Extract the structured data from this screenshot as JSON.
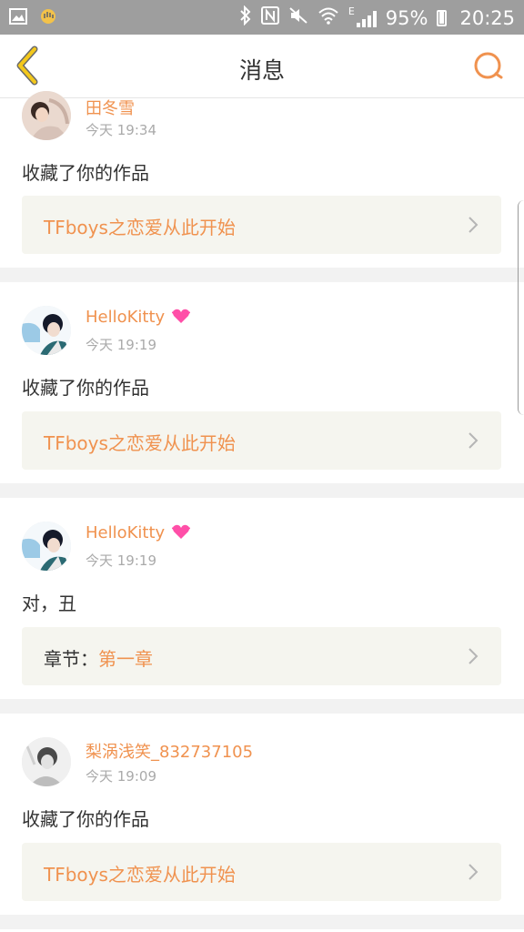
{
  "status_bar": {
    "battery": "95%",
    "time": "20:25",
    "network_type": "E",
    "left_icons": [
      "image-icon",
      "hand-icon"
    ],
    "right_icons": [
      "bluetooth-icon",
      "nfc-icon",
      "mute-icon",
      "wifi-icon",
      "signal-icon",
      "battery-icon"
    ],
    "battery_level": 0.95
  },
  "header": {
    "title": "消息",
    "accent": "#f0924f"
  },
  "messages": [
    {
      "username": "田冬雪",
      "time": "今天 19:34",
      "text": "收藏了你的作品",
      "link_label": "",
      "link_text": "TFboys之恋爱从此开始"
    },
    {
      "username": "HelloKitty",
      "time": "今天 19:19",
      "text": "收藏了你的作品",
      "link_label": "",
      "link_text": "TFboys之恋爱从此开始"
    },
    {
      "username": "HelloKitty",
      "time": "今天 19:19",
      "text": "对，丑",
      "link_label": "章节：",
      "link_text": "第一章"
    },
    {
      "username": "梨涡浅笑_832737105",
      "time": "今天 19:09",
      "text": "收藏了你的作品",
      "link_label": "",
      "link_text": "TFboys之恋爱从此开始"
    }
  ]
}
